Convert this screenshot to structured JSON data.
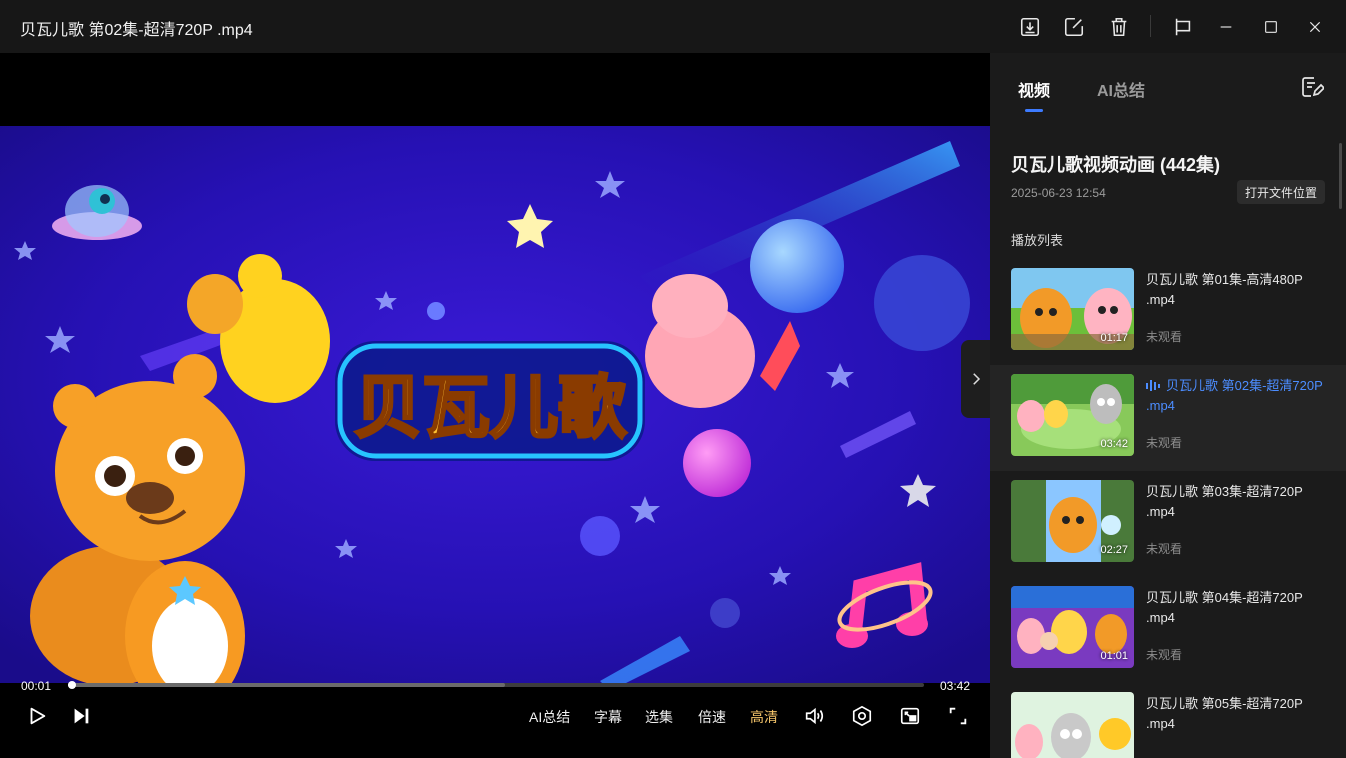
{
  "window": {
    "title": "贝瓦儿歌 第02集-超清720P .mp4"
  },
  "player": {
    "current_time": "00:01",
    "duration": "03:42",
    "progress_fraction": 0.005,
    "buffer_fraction": 0.51,
    "buttons": {
      "ai_summary": "AI总结",
      "subtitles": "字幕",
      "episodes": "选集",
      "speed": "倍速",
      "quality": "高清"
    },
    "quality_color": "#f5c56a"
  },
  "sidebar": {
    "tabs": [
      {
        "label": "视频"
      },
      {
        "label": "AI总结"
      }
    ],
    "series_title": "贝瓦儿歌视频动画 (442集)",
    "series_date": "2025-06-23 12:54",
    "open_location_label": "打开文件位置",
    "playlist_label": "播放列表",
    "items": [
      {
        "title": "贝瓦儿歌 第01集-高清480P .mp4",
        "duration": "01:17",
        "status": "未观看"
      },
      {
        "title": "贝瓦儿歌 第02集-超清720P .mp4",
        "duration": "03:42",
        "status": "未观看"
      },
      {
        "title": "贝瓦儿歌 第03集-超清720P .mp4",
        "duration": "02:27",
        "status": "未观看"
      },
      {
        "title": "贝瓦儿歌 第04集-超清720P .mp4",
        "duration": "01:01",
        "status": "未观看"
      },
      {
        "title": "贝瓦儿歌 第05集-超清720P .mp4",
        "duration": "",
        "status": ""
      }
    ],
    "accent_color": "#3d7bff"
  },
  "video_frame": {
    "logo_text": "贝瓦儿歌"
  }
}
